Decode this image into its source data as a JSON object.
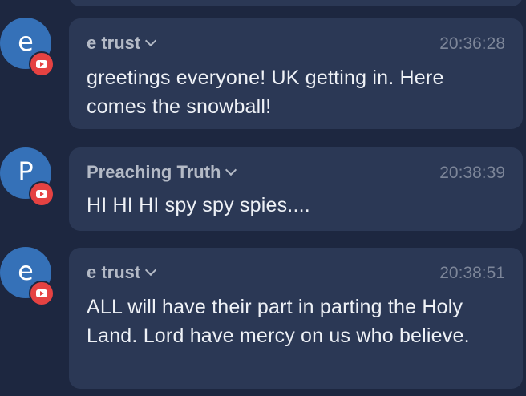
{
  "messages": [
    {
      "avatar_letter": "e",
      "author": "e trust",
      "time": "20:36:28",
      "text": "greetings everyone! UK getting in. Here comes the snowball!",
      "platform_icon": "youtube-icon"
    },
    {
      "avatar_letter": "P",
      "author": "Preaching Truth",
      "time": "20:38:39",
      "text": "HI HI HI spy spy spies....",
      "platform_icon": "youtube-icon"
    },
    {
      "avatar_letter": "e",
      "author": "e trust",
      "time": "20:38:51",
      "text": "ALL will have their part in parting the Holy Land. Lord have mercy on us who believe.",
      "platform_icon": "youtube-icon"
    }
  ],
  "colors": {
    "background": "#1d2740",
    "bubble": "#2b3855",
    "avatar": "#3571b8",
    "youtube_badge": "#e54242"
  }
}
